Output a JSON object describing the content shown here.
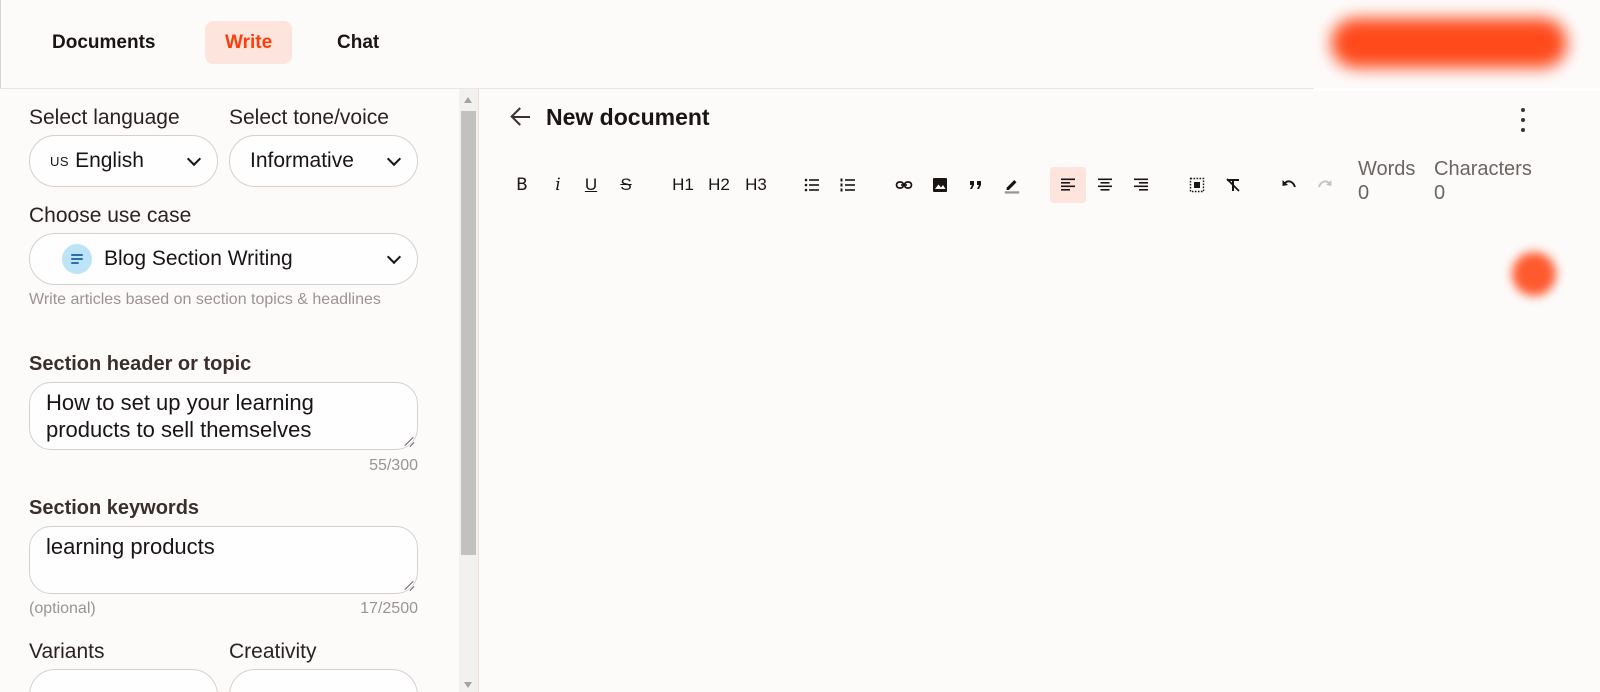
{
  "nav": {
    "tabs": [
      {
        "label": "Documents"
      },
      {
        "label": "Write"
      },
      {
        "label": "Chat"
      }
    ],
    "active_tab": "Write",
    "accent_color": "#ff3d0a"
  },
  "form": {
    "language": {
      "label": "Select language",
      "flag": "US",
      "value": "English"
    },
    "tone": {
      "label": "Select tone/voice",
      "value": "Informative"
    },
    "use_case": {
      "label": "Choose use case",
      "value": "Blog Section Writing",
      "icon": "document-lines-icon",
      "hint": "Write articles based on section topics & headlines"
    },
    "section_header": {
      "label": "Section header or topic",
      "value": "How to set up your learning products to sell themselves",
      "counter": "55/300"
    },
    "section_keywords": {
      "label": "Section keywords",
      "value": "learning products",
      "hint": "(optional)",
      "counter": "17/2500"
    },
    "variants": {
      "label": "Variants"
    },
    "creativity": {
      "label": "Creativity"
    }
  },
  "editor": {
    "title": "New document",
    "toolbar": {
      "bold": "B",
      "italic": "i",
      "underline": "U",
      "strike": "S",
      "h1": "H1",
      "h2": "H2",
      "h3": "H3"
    },
    "stats": {
      "words_label": "Words",
      "words_value": "0",
      "chars_label": "Characters",
      "chars_value": "0"
    }
  }
}
